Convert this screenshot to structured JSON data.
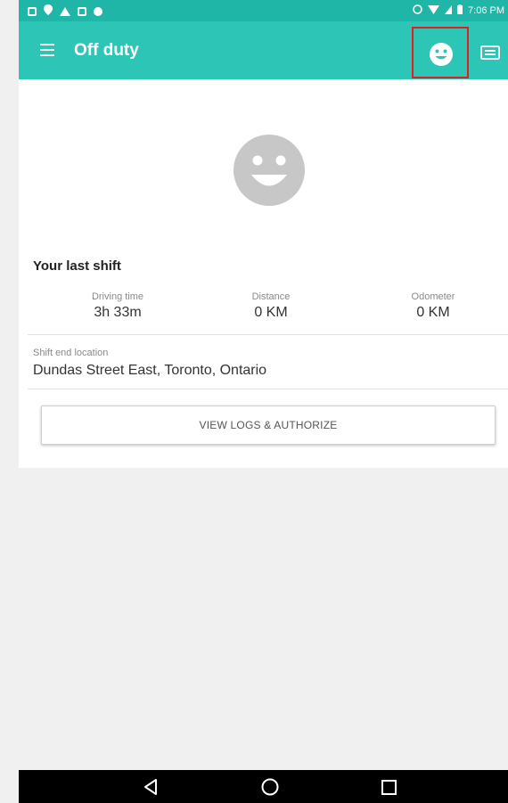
{
  "status_bar": {
    "time": "7:06 PM",
    "icons": [
      "notification-icon",
      "location-icon",
      "warning-icon",
      "image-icon",
      "android-icon",
      "alarm-icon",
      "wifi-icon",
      "signal-icon",
      "battery-icon"
    ]
  },
  "app_bar": {
    "title": "Off duty",
    "menu_icon": "menu-icon",
    "duty_status_icon": "smiley-face-icon",
    "logs_icon": "logbook-icon",
    "background_color": "#2dc6b6"
  },
  "status_avatar": {
    "icon": "smiley-face-icon",
    "color": "#c7c7c7"
  },
  "last_shift": {
    "title": "Your last shift",
    "stats": [
      {
        "label": "Driving time",
        "value": "3h 33m"
      },
      {
        "label": "Distance",
        "value": "0  KM"
      },
      {
        "label": "Odometer",
        "value": "0  KM"
      }
    ],
    "end_location_label": "Shift end location",
    "end_location_value": "Dundas Street East, Toronto, Ontario"
  },
  "actions": {
    "view_logs_label": "VIEW LOGS & AUTHORIZE"
  },
  "nav_bar": {
    "back_icon": "back-icon",
    "home_icon": "home-icon",
    "recents_icon": "recents-icon"
  },
  "highlight_color": "#e02020"
}
